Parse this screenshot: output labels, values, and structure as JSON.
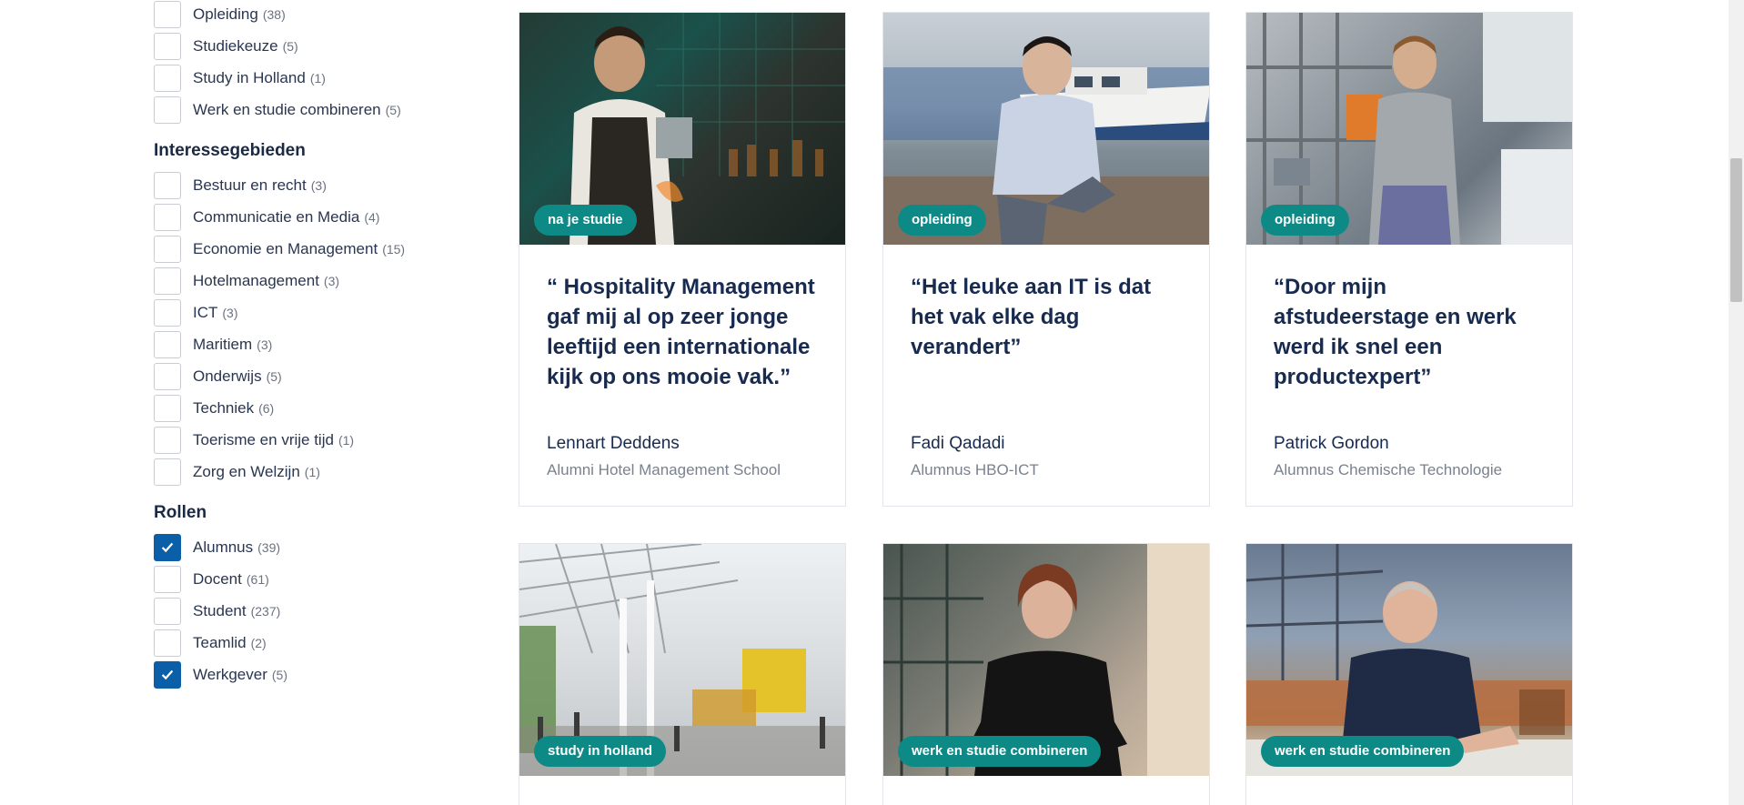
{
  "filters": {
    "top_items": [
      {
        "label": "Opleiding",
        "count": "(38)",
        "checked": false
      },
      {
        "label": "Studiekeuze",
        "count": "(5)",
        "checked": false
      },
      {
        "label": "Study in Holland",
        "count": "(1)",
        "checked": false
      },
      {
        "label": "Werk en studie combineren",
        "count": "(5)",
        "checked": false
      }
    ],
    "interesse": {
      "title": "Interessegebieden",
      "items": [
        {
          "label": "Bestuur en recht",
          "count": "(3)",
          "checked": false
        },
        {
          "label": "Communicatie en Media",
          "count": "(4)",
          "checked": false
        },
        {
          "label": "Economie en Management",
          "count": "(15)",
          "checked": false
        },
        {
          "label": "Hotelmanagement",
          "count": "(3)",
          "checked": false
        },
        {
          "label": "ICT",
          "count": "(3)",
          "checked": false
        },
        {
          "label": "Maritiem",
          "count": "(3)",
          "checked": false
        },
        {
          "label": "Onderwijs",
          "count": "(5)",
          "checked": false
        },
        {
          "label": "Techniek",
          "count": "(6)",
          "checked": false
        },
        {
          "label": "Toerisme en vrije tijd",
          "count": "(1)",
          "checked": false
        },
        {
          "label": "Zorg en Welzijn",
          "count": "(1)",
          "checked": false
        }
      ]
    },
    "rollen": {
      "title": "Rollen",
      "items": [
        {
          "label": "Alumnus",
          "count": "(39)",
          "checked": true
        },
        {
          "label": "Docent",
          "count": "(61)",
          "checked": false
        },
        {
          "label": "Student",
          "count": "(237)",
          "checked": false
        },
        {
          "label": "Teamlid",
          "count": "(2)",
          "checked": false
        },
        {
          "label": "Werkgever",
          "count": "(5)",
          "checked": true
        }
      ]
    }
  },
  "cards": [
    {
      "tag": "na je studie",
      "quote": "“ Hospitality Management gaf mij al op zeer jonge leeftijd een internationale kijk op ons mooie vak.”",
      "name": "Lennart Deddens",
      "role": "Alumni Hotel Management School",
      "image": "bartender-photo"
    },
    {
      "tag": "opleiding",
      "quote": "“Het leuke aan IT is dat het vak elke dag verandert”",
      "name": "Fadi Qadadi",
      "role": "Alumnus HBO-ICT",
      "image": "man-by-boat-photo"
    },
    {
      "tag": "opleiding",
      "quote": "“Door mijn afstudeerstage en werk werd ik snel een productexpert”",
      "name": "Patrick Gordon",
      "role": "Alumnus Chemische Technologie",
      "image": "man-in-lab-photo"
    },
    {
      "tag": "study in holland",
      "image": "campus-hall-photo"
    },
    {
      "tag": "werk en studie combineren",
      "image": "woman-portrait-photo"
    },
    {
      "tag": "werk en studie combineren",
      "image": "man-at-desk-photo"
    }
  ],
  "colors": {
    "accent": "#0e8a86",
    "checkbox_checked": "#0b5ea8",
    "heading": "#172a4f"
  }
}
